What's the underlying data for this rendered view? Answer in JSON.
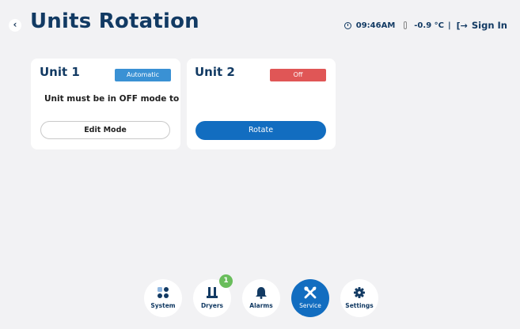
{
  "header": {
    "title": "Units Rotation",
    "time": "09:46AM",
    "temperature": "-0.9 °C",
    "separator": "|",
    "signin_label": "Sign In",
    "icons": {
      "back": "chevron-left-icon",
      "clock": "clock-icon",
      "thermometer": "thermometer-icon",
      "signin": "sign-in-icon"
    }
  },
  "units": [
    {
      "title": "Unit 1",
      "status": "Automatic",
      "status_color": "#3a91d4",
      "message": "Unit must be in OFF mode to rotate",
      "button_label": "Edit Mode"
    },
    {
      "title": "Unit 2",
      "status": "Off",
      "status_color": "#e05656",
      "button_label": "Rotate"
    }
  ],
  "nav": {
    "items": [
      {
        "label": "System",
        "icon": "grid-icon"
      },
      {
        "label": "Dryers",
        "icon": "dryers-icon",
        "badge": "1"
      },
      {
        "label": "Alarms",
        "icon": "bell-icon"
      },
      {
        "label": "Service",
        "icon": "tools-icon",
        "active": true
      },
      {
        "label": "Settings",
        "icon": "gear-icon"
      }
    ],
    "active_color": "#126dc0",
    "badge_color": "#69bd5b"
  }
}
